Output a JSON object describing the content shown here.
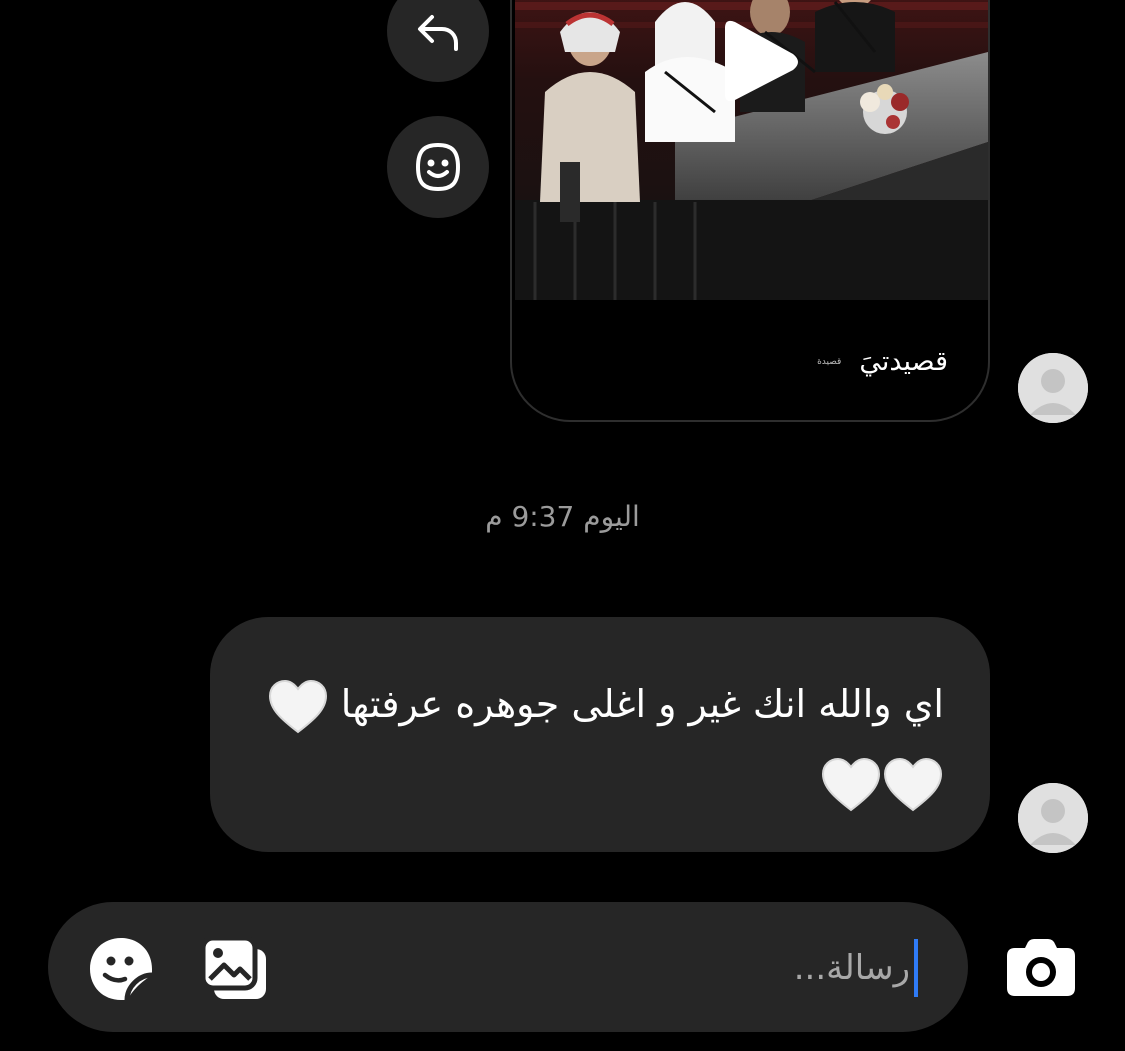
{
  "shared_post": {
    "caption": "قصيدتيَ",
    "caption_small": "قصيدة"
  },
  "actions": {
    "reply_icon": "reply-arrow-icon",
    "react_icon": "smiley-face-icon"
  },
  "thread": {
    "timestamp": "اليوم 9:37 م",
    "message_text": "اي والله انك غير و اغلى جوهره عرفتها",
    "hearts_count": 3
  },
  "composer": {
    "placeholder": "رسالة...",
    "sticker_icon": "sticker-icon",
    "gallery_icon": "gallery-icon",
    "camera_icon": "camera-icon"
  },
  "colors": {
    "background": "#000000",
    "bubble": "#262626",
    "caret": "#2f7bf6",
    "muted_text": "#9b9b9b"
  }
}
